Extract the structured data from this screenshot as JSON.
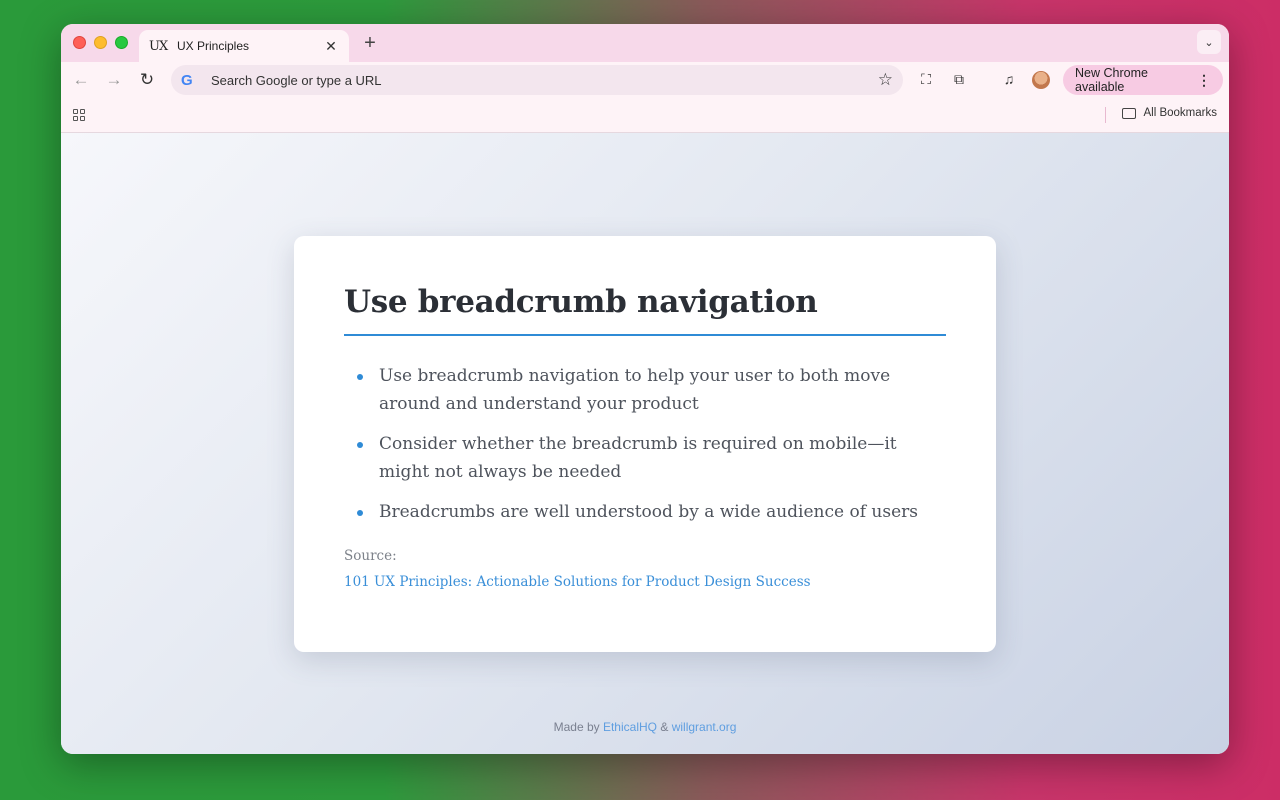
{
  "browser": {
    "tab": {
      "favicon": "UX",
      "title": "UX Principles"
    },
    "omnibox": {
      "placeholder": "Search Google or type a URL"
    },
    "update_button": "New Chrome available",
    "bookmarks": {
      "all_bookmarks": "All Bookmarks"
    }
  },
  "card": {
    "title": "Use breadcrumb navigation",
    "bullets": [
      "Use breadcrumb navigation to help your user to both move around and understand your product",
      "Consider whether the breadcrumb is required on mobile—it might not always be needed",
      "Breadcrumbs are well understood by a wide audience of users"
    ],
    "source_label": "Source:",
    "source_link": "101 UX Principles: Actionable Solutions for Product Design Success"
  },
  "footer": {
    "prefix": "Made by",
    "link1": "EthicalHQ",
    "separator": "&",
    "link2": "willgrant.org"
  },
  "colors": {
    "accent": "#2f8bd6",
    "tabbar": "#f7d9ea"
  }
}
